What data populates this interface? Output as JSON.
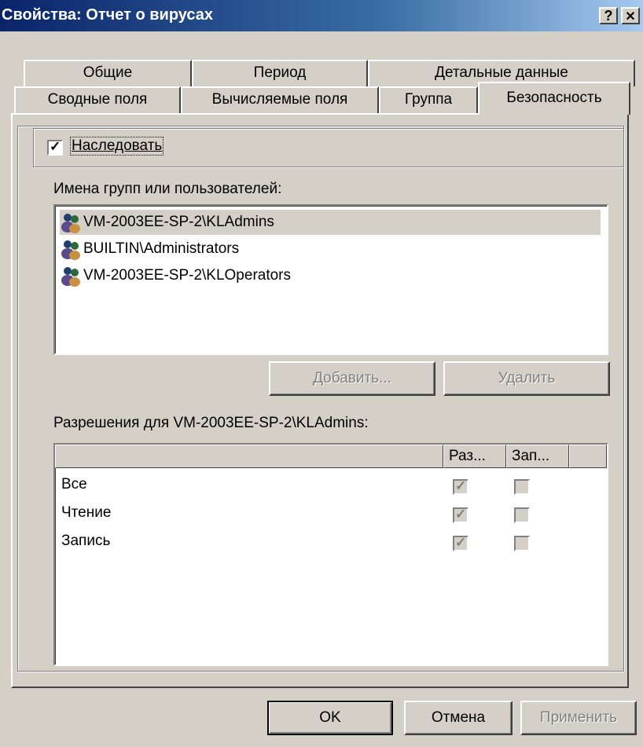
{
  "window": {
    "title": "Свойства: Отчет о вирусах",
    "help_button": "?",
    "close_button": "✕"
  },
  "tabs": {
    "row_back": [
      "Общие",
      "Период",
      "Детальные данные"
    ],
    "row_front": [
      "Сводные поля",
      "Вычисляемые поля",
      "Группа",
      "Безопасность"
    ],
    "active": "Безопасность"
  },
  "security": {
    "inherit_label": "Наследовать",
    "inherit_checked": true,
    "groups_label": "Имена групп или пользователей:",
    "groups": [
      "VM-2003EE-SP-2\\KLAdmins",
      "BUILTIN\\Administrators",
      "VM-2003EE-SP-2\\KLOperators"
    ],
    "selected_group": "VM-2003EE-SP-2\\KLAdmins",
    "add_button": "Добавить...",
    "remove_button": "Удалить",
    "permissions_label": "Разрешения для VM-2003EE-SP-2\\KLAdmins:",
    "permissions_headers": [
      "",
      "Раз...",
      "Зап..."
    ],
    "permissions": [
      {
        "name": "Все",
        "allow": true,
        "deny": false
      },
      {
        "name": "Чтение",
        "allow": true,
        "deny": false
      },
      {
        "name": "Запись",
        "allow": true,
        "deny": false
      }
    ]
  },
  "footer": {
    "ok": "OK",
    "cancel": "Отмена",
    "apply": "Применить"
  },
  "colors": {
    "title_bar_start": "#0a246a",
    "title_bar_end": "#a6caf0",
    "face": "#d4d0c8"
  }
}
